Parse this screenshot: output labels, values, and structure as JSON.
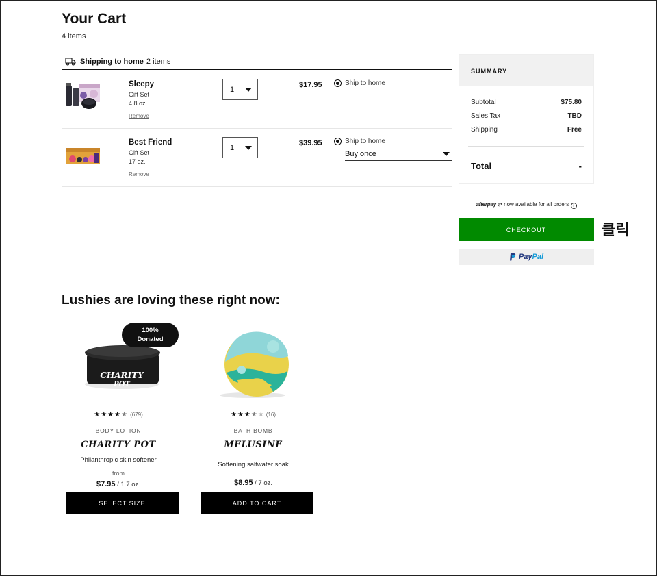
{
  "cart": {
    "title": "Your Cart",
    "item_count": "4 items",
    "shipping_header": {
      "label": "Shipping to home",
      "count": "2 items"
    },
    "items": [
      {
        "name": "Sleepy",
        "type": "Gift Set",
        "size": "4.8 oz.",
        "remove": "Remove",
        "qty": "1",
        "price": "$17.95",
        "ship_option": "Ship to home"
      },
      {
        "name": "Best Friend",
        "type": "Gift Set",
        "size": "17 oz.",
        "remove": "Remove",
        "qty": "1",
        "price": "$39.95",
        "ship_option": "Ship to home",
        "purchase_option": "Buy once"
      }
    ]
  },
  "summary": {
    "title": "SUMMARY",
    "rows": [
      {
        "label": "Subtotal",
        "value": "$75.80"
      },
      {
        "label": "Sales Tax",
        "value": "TBD"
      },
      {
        "label": "Shipping",
        "value": "Free"
      }
    ],
    "total_label": "Total",
    "total_value": "-"
  },
  "afterpay": {
    "logo": "afterpay",
    "text": "now available for all orders",
    "info_glyph": "i"
  },
  "checkout": {
    "label": "CHECKOUT",
    "annotation": "클릭",
    "color": "#018a00"
  },
  "paypal": {
    "part1": "Pay",
    "part2": "Pal"
  },
  "recommendations": {
    "title": "Lushies are loving these right now:",
    "products": [
      {
        "badge_line1": "100%",
        "badge_line2": "Donated",
        "stars": "★★★★",
        "half": "★",
        "empty": "",
        "rating_value": 4.5,
        "count": "(679)",
        "category": "BODY LOTION",
        "name": "CHARITY POT",
        "tagline": "Philanthropic skin softener",
        "from": "from",
        "price": "$7.95",
        "size": " / 1.7 oz.",
        "button": "SELECT SIZE"
      },
      {
        "stars": "★★★",
        "half": "★",
        "empty": "★",
        "rating_value": 3.5,
        "count": "(16)",
        "category": "BATH BOMB",
        "name": "MELUSINE",
        "tagline": "Softening saltwater soak",
        "price": "$8.95",
        "size": " / 7 oz.",
        "button": "ADD TO CART"
      }
    ]
  }
}
